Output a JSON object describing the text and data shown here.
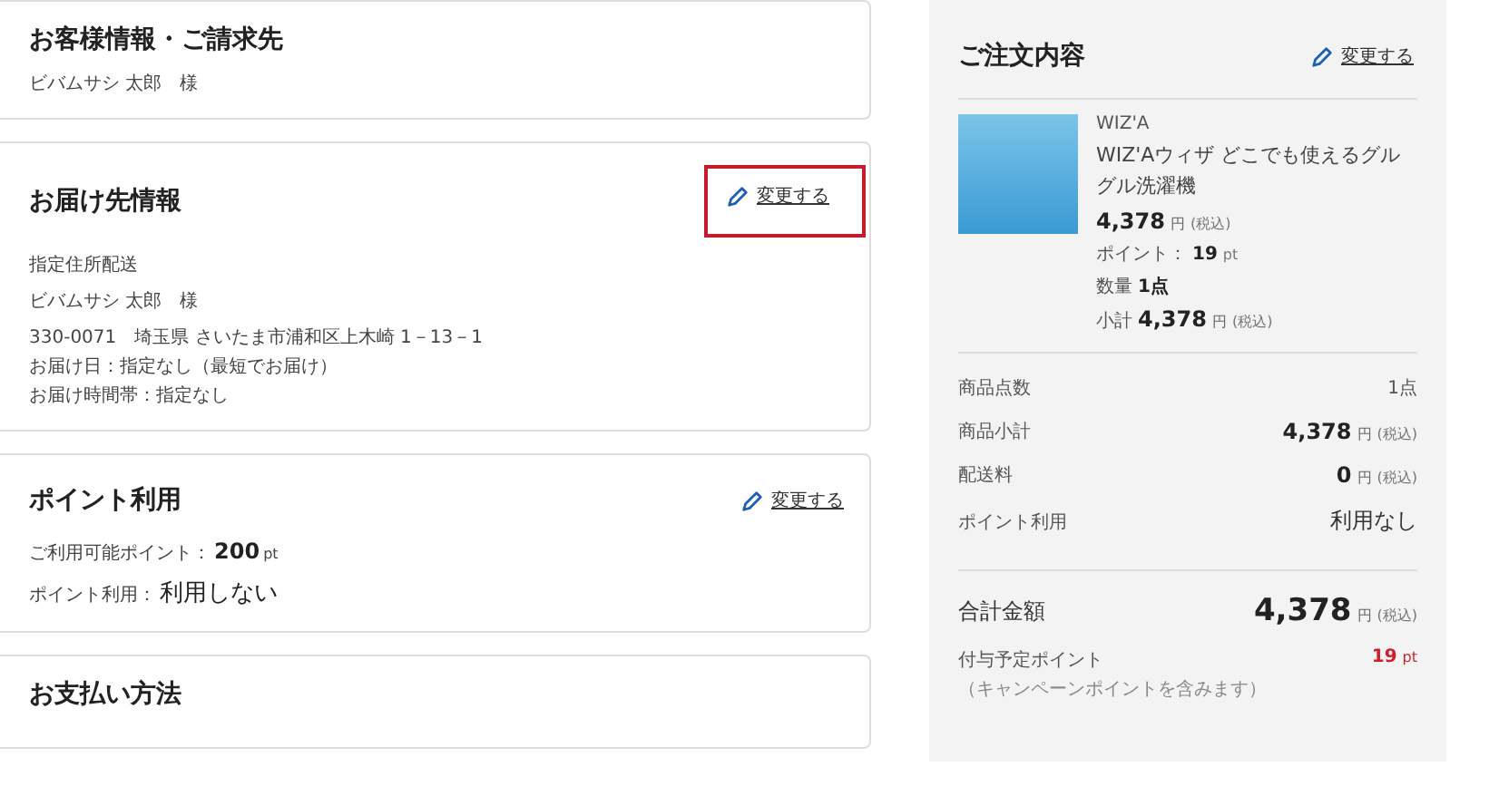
{
  "cards": [
    {
      "title": "お客様情報・ご請求先",
      "rows": [
        {
          "kind": "text",
          "text": "ビバムサシ 太郎　様"
        }
      ]
    },
    {
      "title": "お届け先情報",
      "change_link": {
        "label": "変更する",
        "highlighted": true
      },
      "rows": [
        {
          "kind": "text",
          "text": "指定住所配送"
        },
        {
          "kind": "text",
          "text": "ビバムサシ 太郎　様"
        },
        {
          "kind": "text",
          "text": "330-0071　埼玉県 さいたま市浦和区上木崎 1－13－1"
        },
        {
          "kind": "tight",
          "text": "お届け日：指定なし（最短でお届け）"
        },
        {
          "kind": "tight",
          "text": "お届け時間帯：指定なし"
        }
      ]
    },
    {
      "title": "ポイント利用",
      "change_link": {
        "label": "変更する",
        "highlighted": false
      },
      "rows": [
        {
          "kind": "value",
          "label": "ご利用可能ポイント：",
          "value": "200",
          "unit": "pt"
        },
        {
          "kind": "plain",
          "label": "ポイント利用：",
          "value": "利用しない"
        }
      ]
    },
    {
      "title": "お支払い方法"
    }
  ],
  "order": {
    "title": "ご注文内容",
    "change_link": {
      "label": "変更する",
      "highlighted": false
    },
    "items": [
      {
        "brand": "WIZ'A",
        "name": "WIZ'Aウィザ どこでも使えるグルグル洗濯機",
        "price": "4,378",
        "yen": "円",
        "tax": "(税込)",
        "points_label": "ポイント：",
        "points": "19",
        "points_unit": "pt",
        "qty_label": "数量",
        "qty": "1点",
        "subtotal_label": "小計",
        "subtotal": "4,378",
        "subtotal_yen": "円",
        "subtotal_tax": "(税込)"
      }
    ],
    "summary": [
      {
        "kind": "count",
        "label": "商品点数",
        "value": "1点"
      },
      {
        "kind": "price",
        "label": "商品小計",
        "value": "4,378",
        "yen": "円",
        "tax": "(税込)"
      },
      {
        "kind": "price",
        "label": "配送料",
        "value": "0",
        "yen": "円",
        "tax": "(税込)"
      },
      {
        "kind": "plain",
        "label": "ポイント利用",
        "value": "利用なし"
      }
    ],
    "total": {
      "label": "合計金額",
      "value": "4,378",
      "yen": "円",
      "tax": "(税込)"
    },
    "grant": {
      "label": "付与予定ポイント",
      "note": "（キャンペーンポイントを含みます）",
      "value": "19",
      "unit": "pt"
    }
  }
}
